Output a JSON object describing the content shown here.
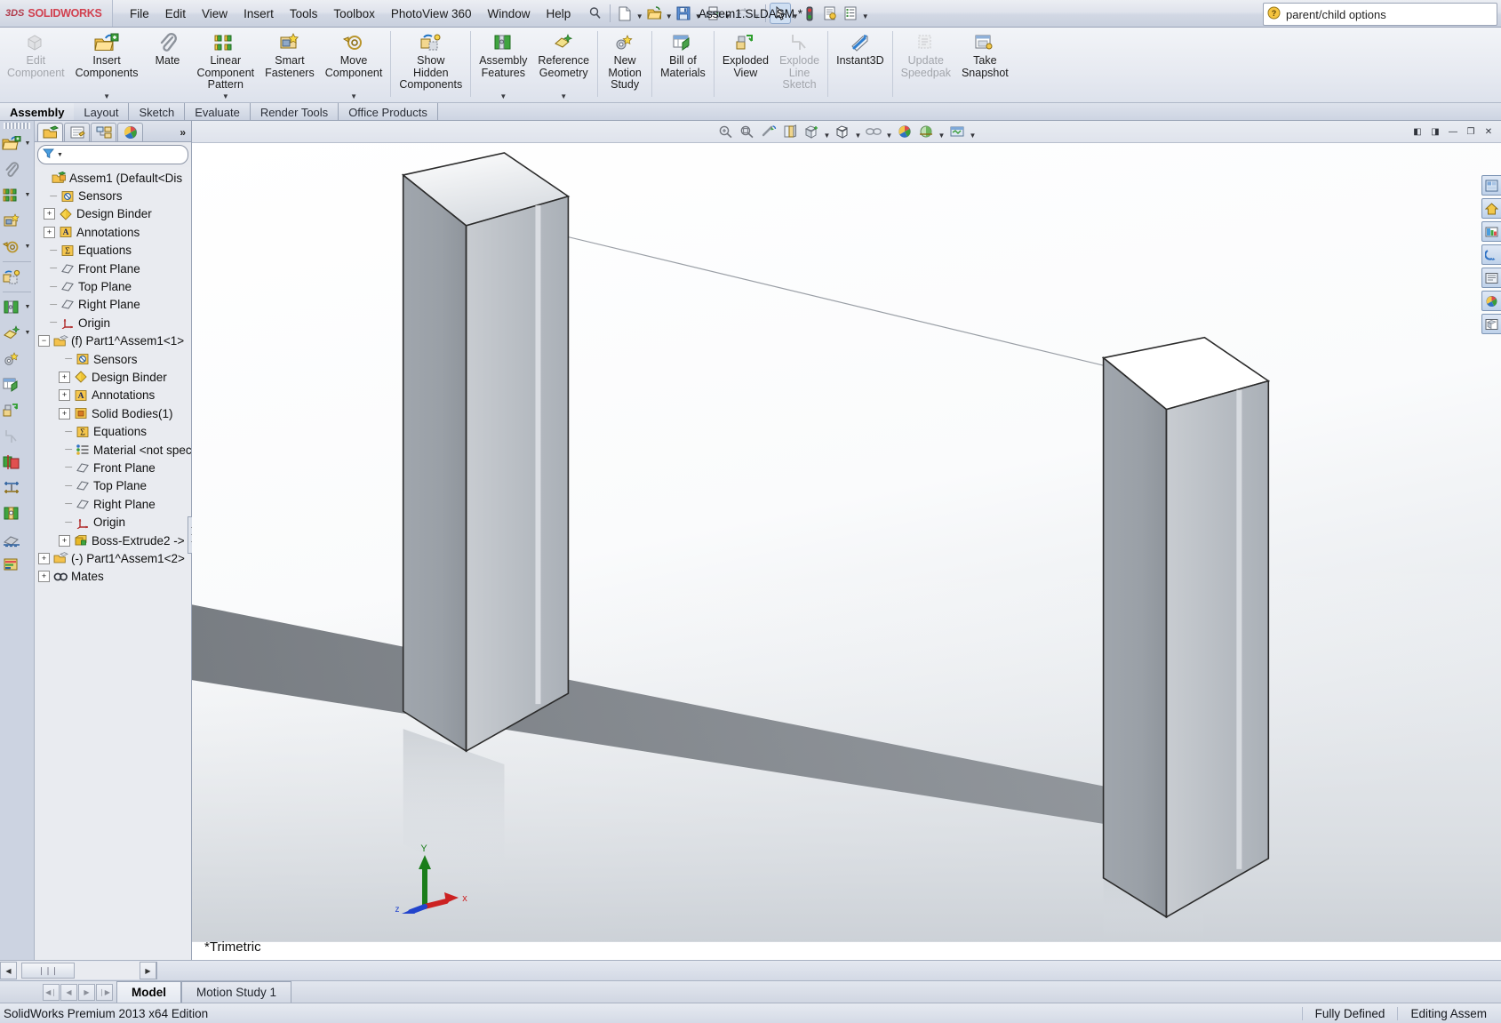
{
  "titlebar": {
    "brand_ds": "3DS",
    "brand_name": "SOLIDWORKS",
    "menus": [
      "File",
      "Edit",
      "View",
      "Insert",
      "Tools",
      "Toolbox",
      "PhotoView 360",
      "Window",
      "Help"
    ],
    "search_icon": "search-icon",
    "quick_access": [
      {
        "name": "new-document-icon",
        "has_caret": true
      },
      {
        "name": "open-document-icon",
        "has_caret": true
      },
      {
        "name": "save-icon",
        "has_caret": true
      },
      {
        "name": "print-icon",
        "has_caret": true
      },
      {
        "name": "undo-icon",
        "has_caret": true,
        "disabled": true
      },
      {
        "name": "select-arrow-icon",
        "has_caret": true,
        "pressed": true
      },
      {
        "name": "rebuild-icon",
        "has_caret": false
      },
      {
        "name": "options-icon",
        "has_caret": false
      },
      {
        "name": "customize-menu-icon",
        "has_caret": true
      }
    ],
    "document_title": "Assem1.SLDASM *",
    "help_search_value": "parent/child options",
    "help_search_icon": "help-question-icon"
  },
  "ribbon": {
    "buttons": [
      {
        "label": "Edit\nComponent",
        "icon": "edit-component-icon",
        "disabled": true,
        "dropdown": false
      },
      {
        "label": "Insert\nComponents",
        "icon": "insert-components-icon",
        "disabled": false,
        "dropdown": true
      },
      {
        "label": "Mate",
        "icon": "mate-paperclip-icon",
        "disabled": false,
        "dropdown": false
      },
      {
        "label": "Linear\nComponent\nPattern",
        "icon": "linear-component-pattern-icon",
        "disabled": false,
        "dropdown": true
      },
      {
        "label": "Smart\nFasteners",
        "icon": "smart-fasteners-icon",
        "disabled": false,
        "dropdown": false
      },
      {
        "label": "Move\nComponent",
        "icon": "move-component-icon",
        "disabled": false,
        "dropdown": true
      },
      {
        "separator_after": true,
        "label": "Show\nHidden\nComponents",
        "icon": "show-hidden-components-icon",
        "disabled": false,
        "dropdown": false
      },
      {
        "separator_before": true,
        "label": "Assembly\nFeatures",
        "icon": "assembly-features-icon",
        "disabled": false,
        "dropdown": true
      },
      {
        "label": "Reference\nGeometry",
        "icon": "reference-geometry-icon",
        "disabled": false,
        "dropdown": true
      },
      {
        "label": "New\nMotion\nStudy",
        "icon": "new-motion-study-icon",
        "disabled": false,
        "dropdown": false
      },
      {
        "label": "Bill of\nMaterials",
        "icon": "bill-of-materials-icon",
        "disabled": false,
        "dropdown": false
      },
      {
        "label": "Exploded\nView",
        "icon": "exploded-view-icon",
        "disabled": false,
        "dropdown": false
      },
      {
        "label": "Explode\nLine\nSketch",
        "icon": "explode-line-sketch-icon",
        "disabled": true,
        "dropdown": false
      },
      {
        "label": "Instant3D",
        "icon": "instant3d-icon",
        "disabled": false,
        "dropdown": false
      },
      {
        "label": "Update\nSpeedpak",
        "icon": "update-speedpak-icon",
        "disabled": true,
        "dropdown": false
      },
      {
        "label": "Take\nSnapshot",
        "icon": "take-snapshot-icon",
        "disabled": false,
        "dropdown": false
      }
    ]
  },
  "command_tabs": {
    "items": [
      "Assembly",
      "Layout",
      "Sketch",
      "Evaluate",
      "Render Tools",
      "Office Products"
    ],
    "active": "Assembly"
  },
  "left_toolbar": {
    "items": [
      {
        "name": "insert-components-icon",
        "caret": true
      },
      {
        "name": "mate-icon",
        "caret": false
      },
      {
        "name": "linear-component-pattern-icon",
        "caret": true
      },
      {
        "name": "smart-fasteners-icon",
        "caret": false
      },
      {
        "name": "move-component-icon",
        "caret": true
      },
      {
        "separator": true
      },
      {
        "name": "show-hidden-components-icon",
        "caret": false
      },
      {
        "separator": true
      },
      {
        "name": "assembly-features-icon",
        "caret": true
      },
      {
        "name": "reference-geometry-icon",
        "caret": true
      },
      {
        "name": "new-motion-study-icon",
        "caret": false
      },
      {
        "name": "bill-of-materials-icon",
        "caret": false
      },
      {
        "name": "exploded-view-icon",
        "caret": false
      },
      {
        "name": "explode-line-sketch-icon",
        "caret": false,
        "disabled": true
      },
      {
        "name": "interference-detection-icon",
        "caret": false
      },
      {
        "name": "measure-icon",
        "caret": false
      },
      {
        "name": "mass-properties-icon",
        "caret": false
      },
      {
        "name": "section-view-icon",
        "caret": false
      },
      {
        "name": "assembly-visualization-icon",
        "caret": false
      }
    ]
  },
  "feature_manager": {
    "tabs": [
      {
        "name": "feature-tree-tab",
        "active": true
      },
      {
        "name": "property-manager-tab",
        "active": false
      },
      {
        "name": "configuration-manager-tab",
        "active": false
      },
      {
        "name": "display-manager-tab",
        "active": false
      }
    ],
    "expand_chevron": "»",
    "filter_placeholder": "",
    "filter_icon": "filter-funnel-icon",
    "tree": [
      {
        "indent": 0,
        "toggle": "none",
        "icon": "assembly-icon",
        "label": "Assem1  (Default<Dis"
      },
      {
        "indent": 1,
        "toggle": "none",
        "icon": "sensors-icon",
        "label": "Sensors"
      },
      {
        "indent": 1,
        "toggle": "plus",
        "icon": "design-binder-icon",
        "label": "Design Binder"
      },
      {
        "indent": 1,
        "toggle": "plus",
        "icon": "annotations-icon",
        "label": "Annotations"
      },
      {
        "indent": 1,
        "toggle": "none",
        "icon": "equations-icon",
        "label": "Equations"
      },
      {
        "indent": 1,
        "toggle": "none",
        "icon": "plane-icon",
        "label": "Front Plane"
      },
      {
        "indent": 1,
        "toggle": "none",
        "icon": "plane-icon",
        "label": "Top Plane"
      },
      {
        "indent": 1,
        "toggle": "none",
        "icon": "plane-icon",
        "label": "Right Plane"
      },
      {
        "indent": 1,
        "toggle": "none",
        "icon": "origin-icon",
        "label": "Origin"
      },
      {
        "indent": 0,
        "toggle": "minus",
        "icon": "part-icon",
        "label": "(f) Part1^Assem1<1>"
      },
      {
        "indent": 2,
        "toggle": "none",
        "icon": "sensors-icon",
        "label": "Sensors"
      },
      {
        "indent": 2,
        "toggle": "plus",
        "icon": "design-binder-icon",
        "label": "Design Binder"
      },
      {
        "indent": 2,
        "toggle": "plus",
        "icon": "annotations-icon",
        "label": "Annotations"
      },
      {
        "indent": 2,
        "toggle": "plus",
        "icon": "solid-bodies-icon",
        "label": "Solid Bodies(1)"
      },
      {
        "indent": 2,
        "toggle": "none",
        "icon": "equations-icon",
        "label": "Equations"
      },
      {
        "indent": 2,
        "toggle": "none",
        "icon": "material-icon",
        "label": "Material <not spec"
      },
      {
        "indent": 2,
        "toggle": "none",
        "icon": "plane-icon",
        "label": "Front Plane"
      },
      {
        "indent": 2,
        "toggle": "none",
        "icon": "plane-icon",
        "label": "Top Plane"
      },
      {
        "indent": 2,
        "toggle": "none",
        "icon": "plane-icon",
        "label": "Right Plane"
      },
      {
        "indent": 2,
        "toggle": "none",
        "icon": "origin-icon",
        "label": "Origin"
      },
      {
        "indent": 2,
        "toggle": "plus",
        "icon": "boss-extrude-icon",
        "label": "Boss-Extrude2 ->"
      },
      {
        "indent": 0,
        "toggle": "plus",
        "icon": "part-icon",
        "label": "(-) Part1^Assem1<2>"
      },
      {
        "indent": 0,
        "toggle": "plus",
        "icon": "mates-icon",
        "label": "Mates"
      }
    ]
  },
  "view_toolbar": {
    "icons": [
      {
        "name": "zoom-to-fit-icon",
        "caret": false
      },
      {
        "name": "zoom-to-area-icon",
        "caret": false
      },
      {
        "name": "previous-view-icon",
        "caret": false
      },
      {
        "name": "section-view-icon",
        "caret": false
      },
      {
        "name": "view-orientation-icon",
        "caret": true
      },
      {
        "name": "display-style-icon",
        "caret": true
      },
      {
        "name": "hide-show-items-icon",
        "caret": true
      },
      {
        "name": "edit-appearance-icon",
        "caret": false
      },
      {
        "name": "apply-scene-icon",
        "caret": true
      },
      {
        "name": "view-settings-icon",
        "caret": true
      }
    ],
    "window_buttons": [
      {
        "name": "restore-left-icon",
        "glyph": "◧"
      },
      {
        "name": "restore-right-icon",
        "glyph": "◨"
      },
      {
        "name": "minimize-window-icon",
        "glyph": "—"
      },
      {
        "name": "restore-window-icon",
        "glyph": "❐"
      },
      {
        "name": "close-window-icon",
        "glyph": "✕"
      }
    ]
  },
  "right_dock": {
    "buttons": [
      {
        "name": "view-palette-icon"
      },
      {
        "name": "appearances-home-icon"
      },
      {
        "name": "appearances-scenes-icon"
      },
      {
        "name": "custom-properties-icon"
      },
      {
        "name": "display-manager-panel-icon"
      },
      {
        "name": "render-tools-icon"
      },
      {
        "name": "drawing-views-icon"
      }
    ]
  },
  "graphics": {
    "view_label": "*Trimetric",
    "triad": {
      "x_label": "x",
      "y_label": "Y",
      "z_label": "z",
      "x_color": "#cc2222",
      "y_color": "#1a7d1a",
      "z_color": "#2244cc"
    },
    "colors": {
      "face_light": "#e9ecef",
      "face_mid": "#9aa0a6",
      "face_dark": "#7e858c",
      "edge": "#2b2b2b",
      "shadow": "#7d8186",
      "background_top": "#ffffff",
      "background_bottom": "#dfe3e8"
    }
  },
  "horizontal_scroll": {
    "left_arrow": "◀",
    "right_arrow": "▶",
    "thumb_glyph": "❘❘❘"
  },
  "bottom_tabs": {
    "nav": [
      "◀❘",
      "◀",
      "▶",
      "❘▶"
    ],
    "tabs": [
      "Model",
      "Motion Study 1"
    ],
    "active": "Model"
  },
  "statusbar": {
    "left": "SolidWorks Premium 2013 x64 Edition",
    "right": [
      "Fully Defined",
      "Editing Assem"
    ]
  }
}
